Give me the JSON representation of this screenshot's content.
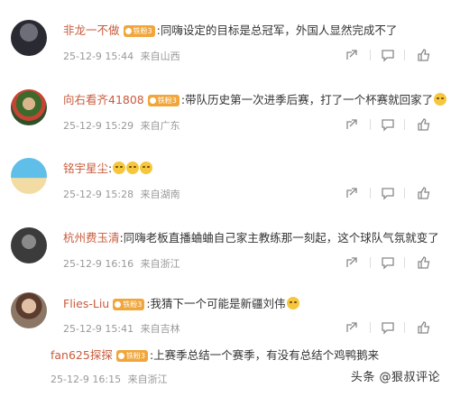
{
  "comments": [
    {
      "username": "非龙一不做",
      "badge": "铁粉3",
      "text": ":同嗨设定的目标是总冠军，外国人显然完成不了",
      "emoji_count": 0,
      "time": "25-12-9 15:44",
      "location": "来自山西"
    },
    {
      "username": "向右看齐41808",
      "badge": "铁粉3",
      "text": ":带队历史第一次进季后赛，打了一个杯赛就回家了",
      "emoji_count": 1,
      "time": "25-12-9 15:29",
      "location": "来自广东"
    },
    {
      "username": "铭宇星尘",
      "badge": "",
      "text": ":",
      "emoji_count": 3,
      "time": "25-12-9 15:28",
      "location": "来自湖南"
    },
    {
      "username": "杭州费玉清",
      "badge": "",
      "text": ":同嗨老板直播蛐蛐自己家主教练那一刻起，这个球队气氛就变了",
      "emoji_count": 0,
      "time": "25-12-9 16:16",
      "location": "来自浙江"
    },
    {
      "username": "Flies-Liu",
      "badge": "铁粉3",
      "text": ":我猜下一个可能是新疆刘伟",
      "emoji_count": 1,
      "time": "25-12-9 15:41",
      "location": "来自吉林"
    }
  ],
  "reply": {
    "username": "fan625探探",
    "badge": "铁粉3",
    "text": ":上赛季总结一个赛季，有没有总结个鸡鸭鹅来",
    "time": "25-12-9 16:15",
    "location": "来自浙江"
  },
  "icons": [
    "share-icon",
    "comment-icon",
    "like-icon"
  ],
  "colors": {
    "username": "#c85b3c",
    "badge": "#f1a63c",
    "meta": "#999999"
  },
  "watermark": "头条 @狠叔评论"
}
